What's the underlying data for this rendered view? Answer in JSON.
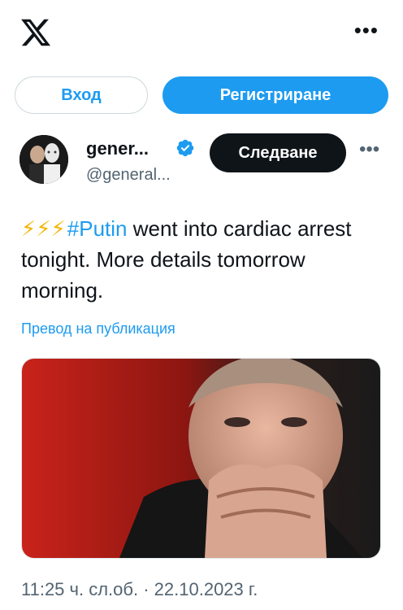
{
  "header": {
    "logo_icon": "x-logo-icon",
    "more_icon": "more-icon",
    "more_glyph": "•••"
  },
  "auth": {
    "login_label": "Вход",
    "signup_label": "Регистриране"
  },
  "author": {
    "name": "gener...",
    "handle": "@general...",
    "verified_icon": "verified-badge-icon",
    "follow_label": "Следване",
    "more_glyph": "•••"
  },
  "tweet": {
    "bolts": "⚡⚡⚡",
    "hashtag": "#Putin",
    "text": " went into cardiac arrest tonight. More details tomorrow morning.",
    "translate_label": "Превод на публикация"
  },
  "media": {
    "image_icon": "photo"
  },
  "meta": {
    "timestamp": "11:25 ч. сл.об. · 22.10.2023 г."
  },
  "colors": {
    "accent": "#1d9bf0",
    "text": "#0f1419",
    "muted": "#536471",
    "follow_bg": "#0f1419"
  }
}
